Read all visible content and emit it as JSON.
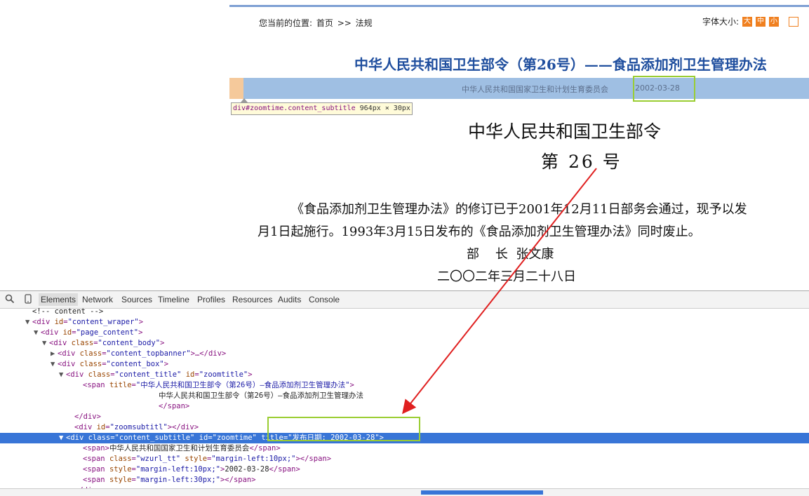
{
  "webpage": {
    "breadcrumb": {
      "prefix": "您当前的位置:",
      "home": "首页",
      "sep": ">>",
      "current": "法规"
    },
    "font_size": {
      "label": "字体大小:",
      "large": "大",
      "medium": "中",
      "small": "小"
    },
    "title": "中华人民共和国卫生部令（第26号）——食品添加剂卫生管理办法",
    "subtitle": {
      "org": "中华人民共和国国家卫生和计划生育委员会",
      "date": "2002-03-28"
    },
    "inspect_tooltip": {
      "selector": "div#zoomtime.content_subtitle",
      "size": "964px × 30px"
    },
    "doc": {
      "heading1": "中华人民共和国卫生部令",
      "heading2": "第 26 号",
      "para1": "《食品添加剂卫生管理办法》的修订已于2001年12月11日部务会通过，现予以发",
      "para2": "月1日起施行。1993年3月15日发布的《食品添加剂卫生管理办法》同时废止。",
      "signer": "部    长  张文康",
      "date": "二〇〇二年三月二十八日"
    }
  },
  "devtools": {
    "tabs": [
      "Elements",
      "Network",
      "Sources",
      "Timeline",
      "Profiles",
      "Resources",
      "Audits",
      "Console"
    ],
    "active_tab": "Elements",
    "lines": [
      {
        "indent": 3,
        "tri": "",
        "html": "<span class='tx'>&lt;!-- content --&gt;</span>"
      },
      {
        "indent": 3,
        "tri": "▼",
        "html": "&lt;div <span class='an'>id</span>=<span class='av'>\"content_wraper\"</span>&gt;"
      },
      {
        "indent": 4,
        "tri": "▼",
        "html": "&lt;div <span class='an'>id</span>=<span class='av'>\"page_content\"</span>&gt;"
      },
      {
        "indent": 5,
        "tri": "▼",
        "html": "&lt;div <span class='an'>class</span>=<span class='av'>\"content_body\"</span>&gt;"
      },
      {
        "indent": 6,
        "tri": "▶",
        "html": "&lt;div <span class='an'>class</span>=<span class='av'>\"content_topbanner\"</span>&gt;…&lt;/div&gt;"
      },
      {
        "indent": 6,
        "tri": "▼",
        "html": "&lt;div <span class='an'>class</span>=<span class='av'>\"content_box\"</span>&gt;"
      },
      {
        "indent": 7,
        "tri": "▼",
        "html": "&lt;div <span class='an'>class</span>=<span class='av'>\"content_title\"</span> <span class='an'>id</span>=<span class='av'>\"zoomtitle\"</span>&gt;"
      },
      {
        "indent": 9,
        "tri": "",
        "html": "&lt;span <span class='an'>title</span>=<span class='av'>\"中华人民共和国卫生部令（第26号）—食品添加剂卫生管理办法\"</span>&gt;"
      },
      {
        "indent": 18,
        "tri": "",
        "html": "<span class='tx'>中华人民共和国卫生部令（第26号）—食品添加剂卫生管理办法</span>"
      },
      {
        "indent": 18,
        "tri": "",
        "html": "&lt;/span&gt;"
      },
      {
        "indent": 8,
        "tri": "",
        "html": "&lt;/div&gt;"
      },
      {
        "indent": 8,
        "tri": "",
        "html": "&lt;div <span class='an'>id</span>=<span class='av'>\"zoomsubtitl\"</span>&gt;&lt;/div&gt;"
      },
      {
        "indent": 7,
        "tri": "▼",
        "selected": true,
        "html": "&lt;div <span class='an'>class</span>=<span class='av'>\"content_subtitle\"</span> <span class='an'>id</span>=<span class='av'>\"zoomtime\"</span> <span class='an'>title</span>=<span class='av'>\"发布日期: 2002-03-28\"</span>&gt;"
      },
      {
        "indent": 9,
        "tri": "",
        "html": "&lt;span&gt;<span class='tx'>中华人民共和国国家卫生和计划生育委员会</span>&lt;/span&gt;"
      },
      {
        "indent": 9,
        "tri": "",
        "html": "&lt;span <span class='an'>class</span>=<span class='av'>\"wzurl_tt\"</span> <span class='an'>style</span>=<span class='av'>\"margin-left:10px;\"</span>&gt;&lt;/span&gt;"
      },
      {
        "indent": 9,
        "tri": "",
        "html": "&lt;span <span class='an'>style</span>=<span class='av'>\"margin-left:10px;\"</span>&gt;<span class='tx'>2002-03-28</span>&lt;/span&gt;"
      },
      {
        "indent": 9,
        "tri": "",
        "html": "&lt;span <span class='an'>style</span>=<span class='av'>\"margin-left:30px;\"</span>&gt;&lt;/span&gt;"
      },
      {
        "indent": 8,
        "tri": "",
        "html": "&lt;/div&gt;"
      }
    ]
  },
  "colors": {
    "highlight_box": "#9acd32",
    "arrow": "#e02020",
    "selection": "#3875d7",
    "title_blue": "#1f4e9e"
  }
}
